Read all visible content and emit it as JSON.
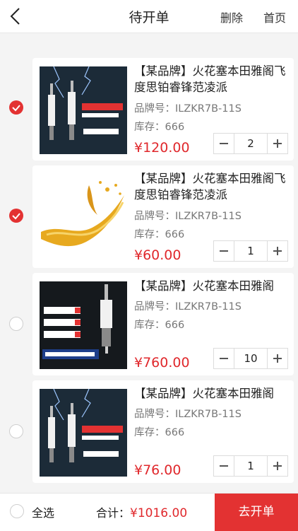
{
  "header": {
    "title": "待开单",
    "delete_label": "删除",
    "home_label": "首页"
  },
  "items": [
    {
      "name": "【某品牌】火花塞本田雅阁飞度思铂睿锋范凌派",
      "brand_no_label": "品牌号：",
      "brand_no": "ILZKR7B-11S",
      "stock_label": "库存：",
      "stock": "666",
      "price": "¥120.00",
      "quantity": "2",
      "selected": true,
      "image": "spark-plug-banner"
    },
    {
      "name": "【某品牌】火花塞本田雅阁飞度思铂睿锋范凌派",
      "brand_no_label": "品牌号：",
      "brand_no": "ILZKR7B-11S",
      "stock_label": "库存：",
      "stock": "666",
      "price": "¥60.00",
      "quantity": "1",
      "selected": true,
      "image": "engine-oil-splash"
    },
    {
      "name": "【某品牌】火花塞本田雅阁",
      "brand_no_label": "品牌号：",
      "brand_no": "ILZKR7B-11S",
      "stock_label": "库存：",
      "stock": "666",
      "price": "¥760.00",
      "quantity": "10",
      "selected": false,
      "image": "spark-plug-features"
    },
    {
      "name": "【某品牌】火花塞本田雅阁",
      "brand_no_label": "品牌号：",
      "brand_no": "ILZKR7B-11S",
      "stock_label": "库存：",
      "stock": "666",
      "price": "¥76.00",
      "quantity": "1",
      "selected": false,
      "image": "spark-plug-banner"
    }
  ],
  "footer": {
    "select_all_label": "全选",
    "total_label": "合计：",
    "total_value": "¥1016.00",
    "submit_label": "去开单"
  },
  "colors": {
    "accent": "#e33232",
    "price": "#e0282c"
  },
  "icons": [
    "back-chevron-icon",
    "check-icon",
    "minus-icon",
    "plus-icon"
  ]
}
